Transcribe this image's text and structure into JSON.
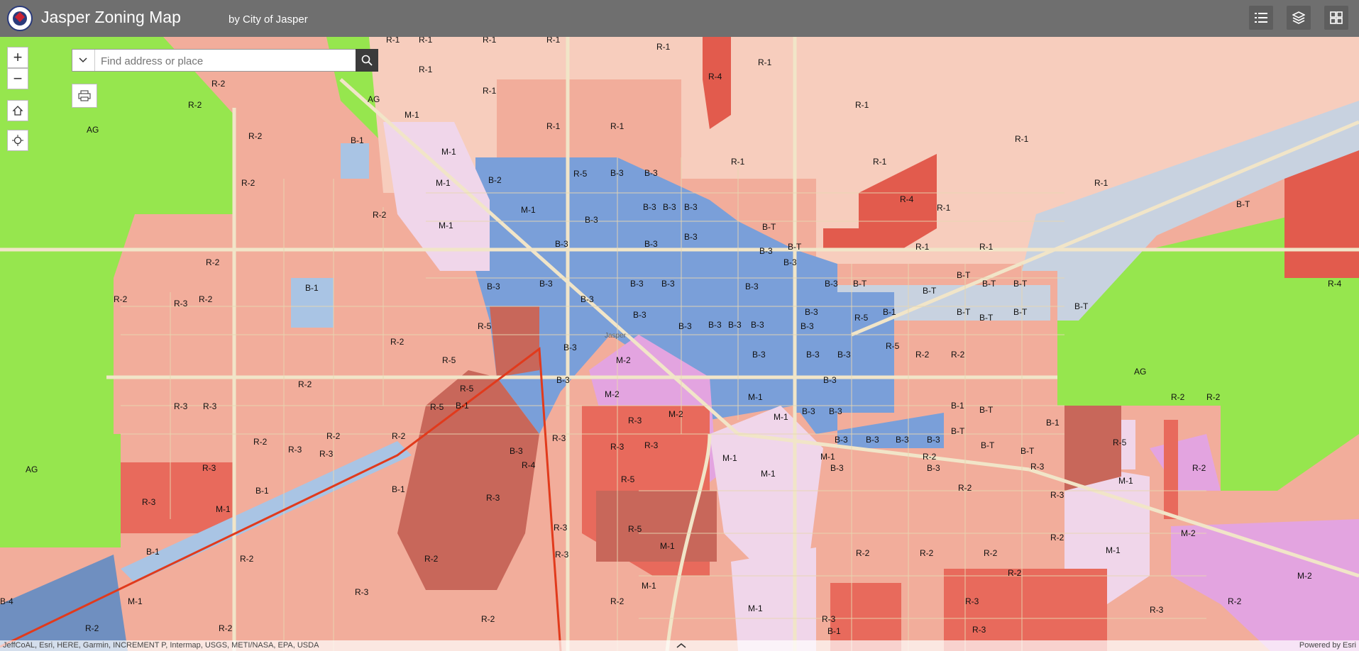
{
  "header": {
    "title": "Jasper Zoning Map",
    "subtitle": "by City of Jasper",
    "buttons": [
      "legend-button",
      "layers-button",
      "basemap-gallery-button"
    ]
  },
  "controls": {
    "zoom_in": "+",
    "zoom_out": "−",
    "home": "home-icon",
    "locate": "locate-icon",
    "print": "print-icon"
  },
  "search": {
    "placeholder": "Find address or place",
    "value": ""
  },
  "attribution": {
    "sources": "JeffCoAL, Esri, HERE, Garmin, INCREMENT P, Intermap, USGS, METI/NASA, EPA, USDA",
    "powered_by": "Powered by Esri"
  },
  "map_labels": [
    "AG",
    "R-1",
    "R-2",
    "R-3",
    "R-4",
    "R-5",
    "B-1",
    "B-3",
    "B-4",
    "B-T",
    "M-1",
    "M-2",
    "Jasper"
  ],
  "zone_colors": {
    "AG": "#96e64e",
    "R-1": "#f7cdbd",
    "R-2": "#f2ad9b",
    "R-3": "#e86a5c",
    "R-4": "#e25b4d",
    "R-5": "#c8675a",
    "B-1": "#a9c4e4",
    "B-3": "#7a9fd9",
    "B-T": "#c8d2e0",
    "M-1": "#f0d6ea",
    "M-2": "#e3a4e0",
    "roads": "#f1e5c8"
  }
}
